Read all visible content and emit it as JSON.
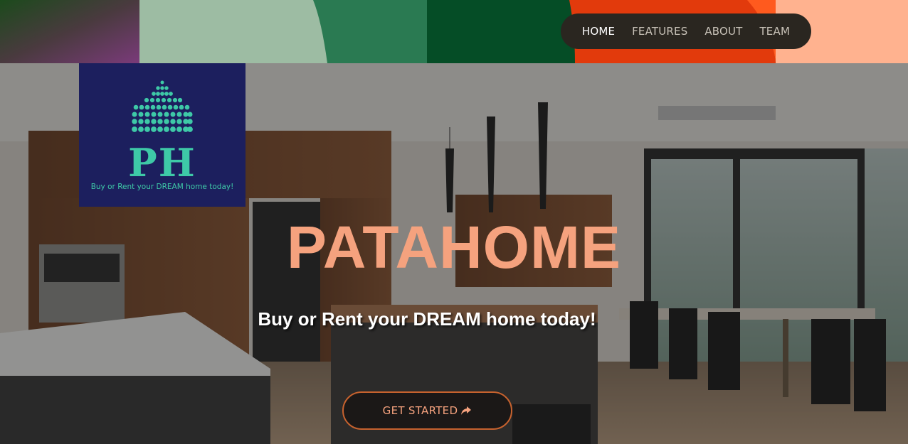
{
  "colors": {
    "accent": "#f5a27e",
    "cta_border": "#c7622e",
    "logo_bg": "#1c1f5e",
    "logo_fg": "#3ec9a7",
    "nav_bg": "#2a2620"
  },
  "nav": {
    "items": [
      {
        "label": "HOME",
        "active": true
      },
      {
        "label": "FEATURES",
        "active": false
      },
      {
        "label": "ABOUT",
        "active": false
      },
      {
        "label": "TEAM",
        "active": false
      }
    ]
  },
  "logo": {
    "monogram": "PH",
    "tagline": "Buy or Rent your DREAM home today!"
  },
  "hero": {
    "title": "PATAHOME",
    "subtitle": "Buy or Rent your DREAM home today!",
    "cta_label": "GET STARTED",
    "cta_icon": "share-arrow-icon"
  }
}
